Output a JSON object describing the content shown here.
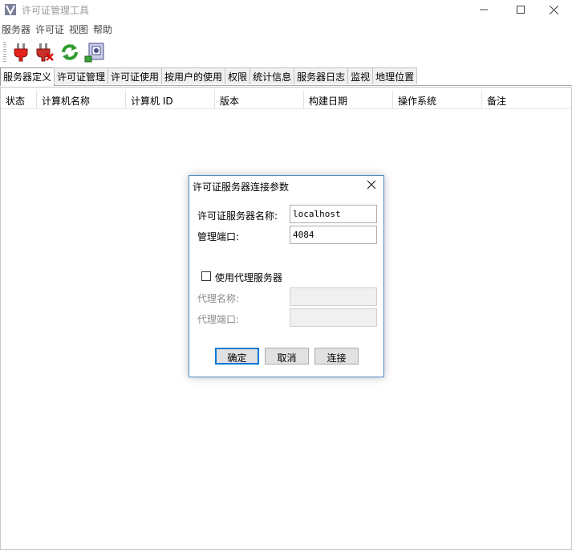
{
  "window": {
    "title": "许可证管理工具",
    "minimize": "—",
    "maximize": "☐",
    "close": "✕"
  },
  "menu": [
    "服务器",
    "许可证",
    "视图",
    "帮助"
  ],
  "toolbar": [
    {
      "icon": "plug-connect-icon"
    },
    {
      "icon": "plug-disconnect-icon"
    },
    {
      "icon": "refresh-icon"
    },
    {
      "icon": "server-settings-icon"
    }
  ],
  "tabs": [
    "服务器定义",
    "许可证管理",
    "许可证使用",
    "按用户的使用",
    "权限",
    "统计信息",
    "服务器日志",
    "监视",
    "地理位置"
  ],
  "active_tab": 0,
  "columns": [
    "状态",
    "计算机名称",
    "计算机 ID",
    "版本",
    "构建日期",
    "操作系统",
    "备注"
  ],
  "dialog": {
    "title": "许可证服务器连接参数",
    "server_name_label": "许可证服务器名称:",
    "server_name_value": "localhost",
    "port_label": "管理端口:",
    "port_value": "4084",
    "use_proxy_label": "使用代理服务器",
    "use_proxy_checked": false,
    "proxy_name_label": "代理名称:",
    "proxy_name_value": "",
    "proxy_port_label": "代理端口:",
    "proxy_port_value": "",
    "ok_label": "确定",
    "cancel_label": "取消",
    "connect_label": "连接"
  }
}
